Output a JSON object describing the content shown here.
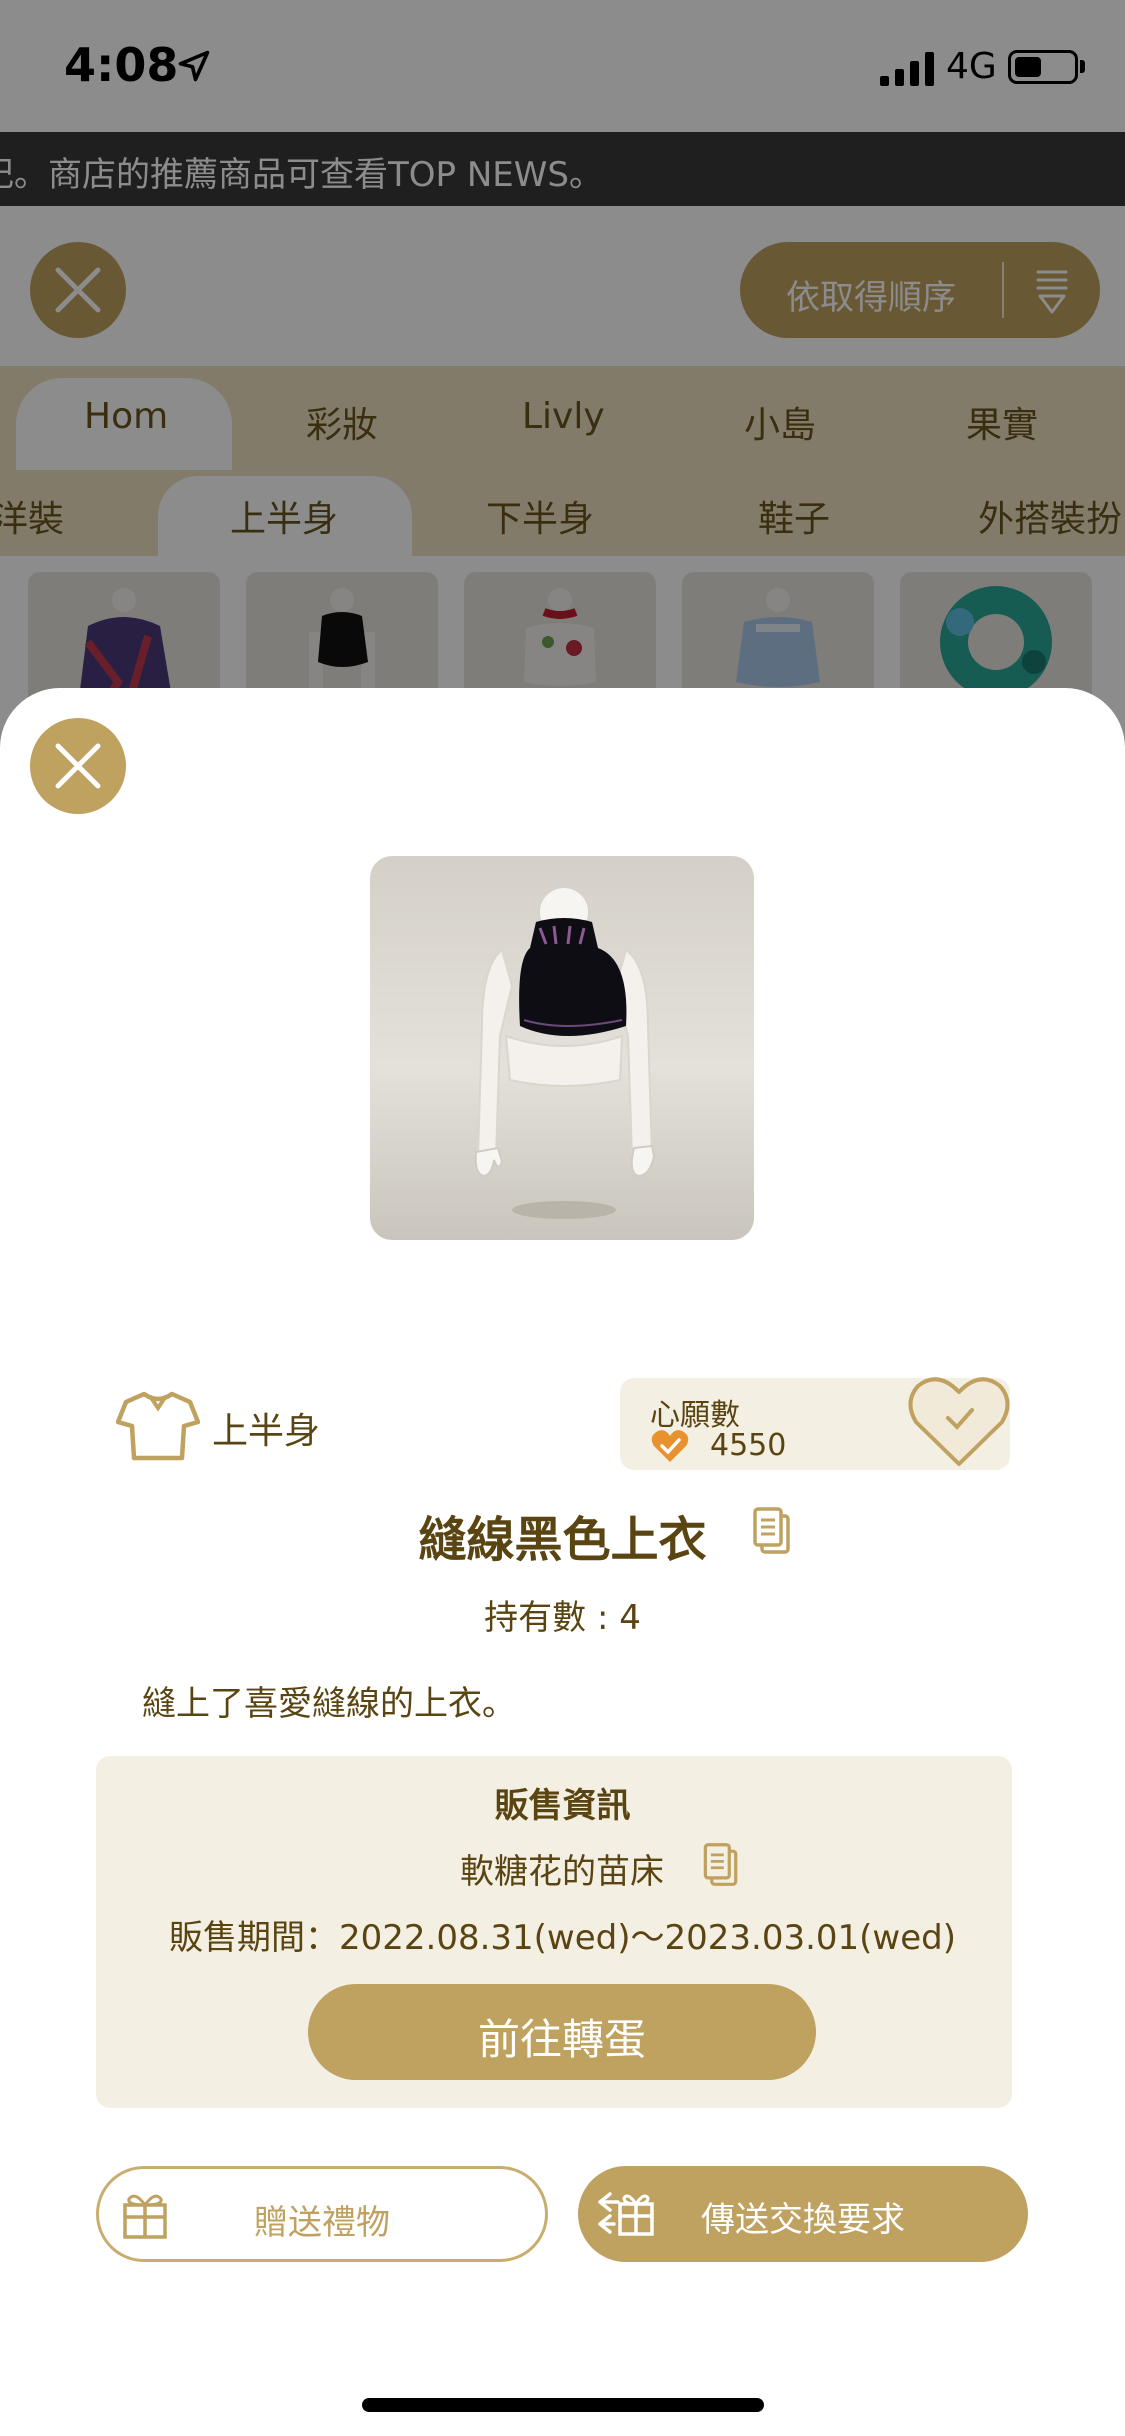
{
  "status_bar": {
    "time": "4:08",
    "network": "4G"
  },
  "ticker": {
    "text": "記。商店的推薦商品可查看TOP NEWS。"
  },
  "toolbar": {
    "sort_label": "依取得順序"
  },
  "category_tabs": [
    "Hom",
    "彩妝",
    "Livly",
    "小島",
    "果實"
  ],
  "sub_tabs": [
    "洋裝",
    "上半身",
    "下半身",
    "鞋子",
    "外搭裝扮"
  ],
  "item": {
    "category": "上半身",
    "wish_label": "心願數",
    "wish_count": "4550",
    "name": "縫線黑色上衣",
    "owned": "持有數 : 4",
    "description": "縫上了喜愛縫線的上衣。"
  },
  "sale": {
    "title": "販售資訊",
    "shop": "軟糖花的苗床",
    "period": "販售期間：2022.08.31(wed)〜2023.03.01(wed)",
    "button": "前往轉蛋"
  },
  "actions": {
    "gift": "贈送禮物",
    "trade": "傳送交換要求"
  },
  "colors": {
    "gold": "#bfa160",
    "brown_text": "#5a4512",
    "cream": "#f4efe3",
    "tab_bar": "#ede1c2"
  }
}
